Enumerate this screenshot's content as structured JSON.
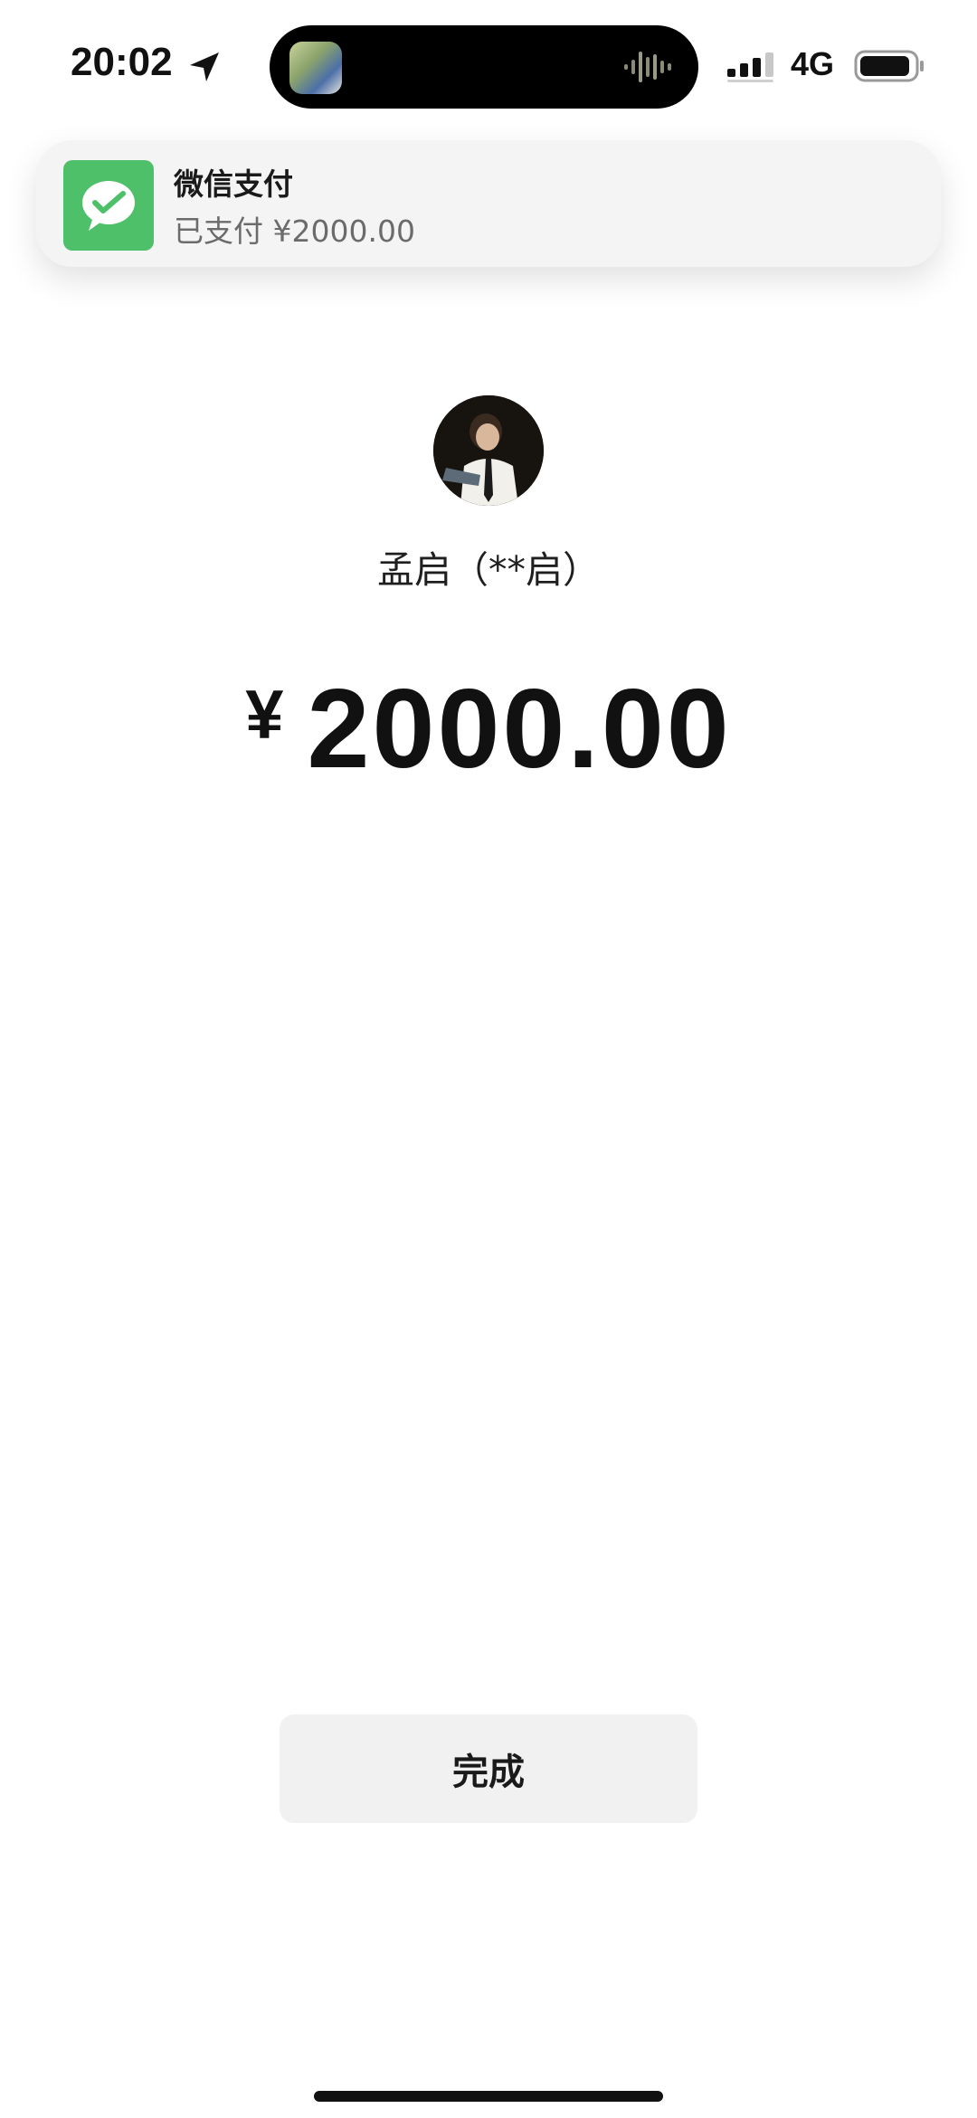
{
  "status_bar": {
    "time": "20:02",
    "location_icon": "location-arrow-icon",
    "network": "4G",
    "signal_icon": "cellular-signal-icon",
    "battery_icon": "battery-icon",
    "island_thumbnail": "now-playing-artwork",
    "island_waveform_icon": "audio-waveform-icon"
  },
  "notification": {
    "app_name": "微信支付",
    "message": "已支付 ¥2000.00",
    "icon": "wechat-pay-icon",
    "icon_color": "#4fc06a"
  },
  "payee": {
    "name": "孟启（**启）",
    "avatar": "payee-avatar"
  },
  "amount": {
    "currency": "¥",
    "value": "2000.00"
  },
  "actions": {
    "done_label": "完成"
  },
  "colors": {
    "background": "#ffffff",
    "button_bg": "#f1f1f1",
    "accent_green": "#4fc06a"
  }
}
